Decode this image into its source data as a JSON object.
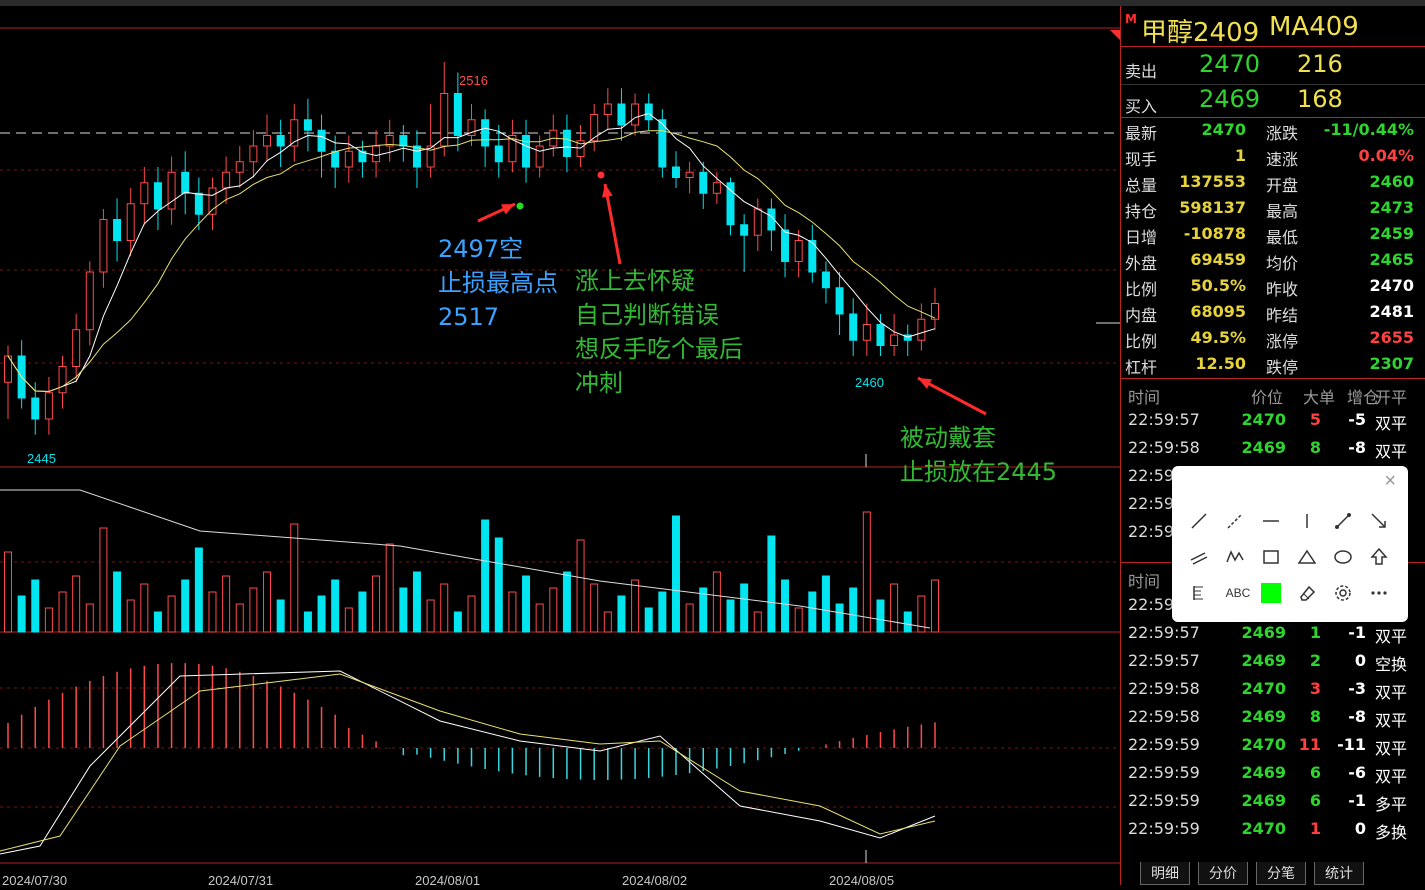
{
  "instrument": {
    "marker": "M",
    "name": "甲醇2409",
    "code": "MA409"
  },
  "quote": {
    "sell_label": "卖出",
    "sell_price": "2470",
    "sell_vol": "216",
    "buy_label": "买入",
    "buy_price": "2469",
    "buy_vol": "168",
    "left": [
      {
        "label": "最新",
        "value": "2470",
        "color": "g"
      },
      {
        "label": "现手",
        "value": "1",
        "color": "y"
      },
      {
        "label": "总量",
        "value": "137553",
        "color": "y"
      },
      {
        "label": "持仓",
        "value": "598137",
        "color": "y"
      },
      {
        "label": "日增",
        "value": "-10878",
        "color": "y"
      },
      {
        "label": "外盘",
        "value": "69459",
        "color": "y"
      },
      {
        "label": "比例",
        "value": "50.5%",
        "color": "y"
      },
      {
        "label": "内盘",
        "value": "68095",
        "color": "y"
      },
      {
        "label": "比例",
        "value": "49.5%",
        "color": "y"
      },
      {
        "label": "杠杆",
        "value": "12.50",
        "color": "y"
      }
    ],
    "right": [
      {
        "label": "涨跌",
        "value": "-11/0.44%",
        "color": "g"
      },
      {
        "label": "速涨",
        "value": "0.04%",
        "color": "r"
      },
      {
        "label": "开盘",
        "value": "2460",
        "color": "g"
      },
      {
        "label": "最高",
        "value": "2473",
        "color": "g"
      },
      {
        "label": "最低",
        "value": "2459",
        "color": "g"
      },
      {
        "label": "均价",
        "value": "2465",
        "color": "g"
      },
      {
        "label": "昨收",
        "value": "2470",
        "color": "w"
      },
      {
        "label": "昨结",
        "value": "2481",
        "color": "w"
      },
      {
        "label": "涨停",
        "value": "2655",
        "color": "r"
      },
      {
        "label": "跌停",
        "value": "2307",
        "color": "g"
      }
    ]
  },
  "ticks1": {
    "headers": [
      "时间",
      "价位",
      "大单",
      "增仓",
      "开平"
    ],
    "rows": [
      {
        "time": "22:59:57",
        "price": "2470",
        "big": "5",
        "bigc": "r",
        "inc": "-5",
        "open": "双平"
      },
      {
        "time": "22:59:58",
        "price": "2469",
        "big": "8",
        "bigc": "g",
        "inc": "-8",
        "open": "双平"
      },
      {
        "time": "22:59",
        "price": "",
        "big": "",
        "bigc": "g",
        "inc": "",
        "open": ""
      },
      {
        "time": "22:59",
        "price": "",
        "big": "",
        "bigc": "g",
        "inc": "",
        "open": ""
      },
      {
        "time": "22:59",
        "price": "",
        "big": "",
        "bigc": "g",
        "inc": "",
        "open": ""
      }
    ]
  },
  "ticks2": {
    "header": "时间",
    "rows": [
      {
        "time": "22:59",
        "price": "",
        "big": "",
        "bigc": "g",
        "inc": "",
        "open": ""
      },
      {
        "time": "22:59:57",
        "price": "2469",
        "big": "1",
        "bigc": "g",
        "inc": "-1",
        "open": "双平"
      },
      {
        "time": "22:59:57",
        "price": "2469",
        "big": "2",
        "bigc": "g",
        "inc": "0",
        "open": "空换"
      },
      {
        "time": "22:59:58",
        "price": "2470",
        "big": "3",
        "bigc": "r",
        "inc": "-3",
        "open": "双平"
      },
      {
        "time": "22:59:58",
        "price": "2469",
        "big": "8",
        "bigc": "g",
        "inc": "-8",
        "open": "双平"
      },
      {
        "time": "22:59:59",
        "price": "2470",
        "big": "11",
        "bigc": "r",
        "inc": "-11",
        "open": "双平"
      },
      {
        "time": "22:59:59",
        "price": "2469",
        "big": "6",
        "bigc": "g",
        "inc": "-6",
        "open": "双平"
      },
      {
        "time": "22:59:59",
        "price": "2469",
        "big": "6",
        "bigc": "g",
        "inc": "-1",
        "open": "多平"
      },
      {
        "time": "22:59:59",
        "price": "2470",
        "big": "1",
        "bigc": "r",
        "inc": "0",
        "open": "多换"
      }
    ]
  },
  "tabs": [
    "明细",
    "分价",
    "分笔",
    "统计"
  ],
  "annotations": {
    "short": [
      "2497空",
      "止损最高点",
      "2517"
    ],
    "doubt": [
      "涨上去怀疑",
      "自己判断错误",
      "想反手吃个最后",
      "冲刺"
    ],
    "trapped": [
      "被动戴套",
      "止损放在2445"
    ]
  },
  "price_labels": {
    "high": "2516",
    "low_left": "2445",
    "low_right": "2460"
  },
  "dates": [
    "2024/07/30",
    "2024/07/31",
    "2024/08/01",
    "2024/08/02",
    "2024/08/05"
  ],
  "toolbox": {
    "close": "×",
    "abc": "ABC",
    "color": "#00ff00"
  },
  "colors": {
    "up": "#ff4a4a",
    "down": "#00e5f0",
    "grid": "#b22222",
    "ma1": "#ffffff",
    "ma2": "#e8e070"
  },
  "chart_data": {
    "type": "candlestick",
    "price_high": 2516,
    "price_low": 2445,
    "candles": [
      [
        2455,
        2460,
        2448,
        2462
      ],
      [
        2460,
        2452,
        2450,
        2463
      ],
      [
        2452,
        2448,
        2445,
        2455
      ],
      [
        2448,
        2453,
        2445,
        2456
      ],
      [
        2453,
        2458,
        2450,
        2460
      ],
      [
        2458,
        2465,
        2455,
        2468
      ],
      [
        2465,
        2476,
        2462,
        2478
      ],
      [
        2476,
        2486,
        2473,
        2488
      ],
      [
        2486,
        2482,
        2478,
        2490
      ],
      [
        2482,
        2489,
        2479,
        2492
      ],
      [
        2489,
        2493,
        2485,
        2496
      ],
      [
        2493,
        2488,
        2484,
        2496
      ],
      [
        2488,
        2495,
        2485,
        2498
      ],
      [
        2495,
        2491,
        2487,
        2499
      ],
      [
        2491,
        2487,
        2484,
        2494
      ],
      [
        2487,
        2492,
        2484,
        2494
      ],
      [
        2492,
        2495,
        2489,
        2498
      ],
      [
        2495,
        2497,
        2492,
        2500
      ],
      [
        2497,
        2500,
        2494,
        2503
      ],
      [
        2500,
        2502,
        2497,
        2506
      ],
      [
        2502,
        2500,
        2496,
        2505
      ],
      [
        2500,
        2505,
        2497,
        2508
      ],
      [
        2505,
        2503,
        2499,
        2509
      ],
      [
        2503,
        2499,
        2494,
        2506
      ],
      [
        2499,
        2496,
        2492,
        2502
      ],
      [
        2496,
        2499,
        2493,
        2502
      ],
      [
        2499,
        2497,
        2494,
        2501
      ],
      [
        2497,
        2500,
        2494,
        2503
      ],
      [
        2500,
        2502,
        2497,
        2505
      ],
      [
        2502,
        2500,
        2497,
        2504
      ],
      [
        2500,
        2496,
        2492,
        2503
      ],
      [
        2496,
        2500,
        2494,
        2508
      ],
      [
        2500,
        2510,
        2498,
        2516
      ],
      [
        2510,
        2502,
        2499,
        2514
      ],
      [
        2502,
        2505,
        2500,
        2508
      ],
      [
        2505,
        2500,
        2496,
        2507
      ],
      [
        2500,
        2497,
        2494,
        2504
      ],
      [
        2497,
        2502,
        2495,
        2505
      ],
      [
        2502,
        2496,
        2493,
        2505
      ],
      [
        2496,
        2500,
        2494,
        2502
      ],
      [
        2500,
        2503,
        2498,
        2506
      ],
      [
        2503,
        2498,
        2495,
        2506
      ],
      [
        2498,
        2501,
        2496,
        2504
      ],
      [
        2501,
        2506,
        2499,
        2508
      ],
      [
        2506,
        2508,
        2503,
        2511
      ],
      [
        2508,
        2504,
        2501,
        2511
      ],
      [
        2504,
        2508,
        2502,
        2510
      ],
      [
        2508,
        2505,
        2503,
        2510
      ],
      [
        2505,
        2496,
        2494,
        2507
      ],
      [
        2496,
        2494,
        2492,
        2499
      ],
      [
        2494,
        2495,
        2491,
        2497
      ],
      [
        2495,
        2491,
        2488,
        2497
      ],
      [
        2491,
        2493,
        2489,
        2495
      ],
      [
        2493,
        2485,
        2483,
        2494
      ],
      [
        2485,
        2483,
        2476,
        2487
      ],
      [
        2483,
        2488,
        2480,
        2490
      ],
      [
        2488,
        2484,
        2480,
        2490
      ],
      [
        2484,
        2478,
        2475,
        2487
      ],
      [
        2478,
        2482,
        2475,
        2484
      ],
      [
        2482,
        2476,
        2474,
        2485
      ],
      [
        2476,
        2473,
        2470,
        2478
      ],
      [
        2473,
        2468,
        2464,
        2476
      ],
      [
        2468,
        2463,
        2460,
        2471
      ],
      [
        2463,
        2466,
        2460,
        2470
      ],
      [
        2466,
        2462,
        2460,
        2468
      ],
      [
        2462,
        2464,
        2460,
        2468
      ],
      [
        2464,
        2463,
        2460,
        2466
      ],
      [
        2463,
        2467,
        2461,
        2470
      ],
      [
        2467,
        2470,
        2465,
        2473
      ]
    ]
  }
}
